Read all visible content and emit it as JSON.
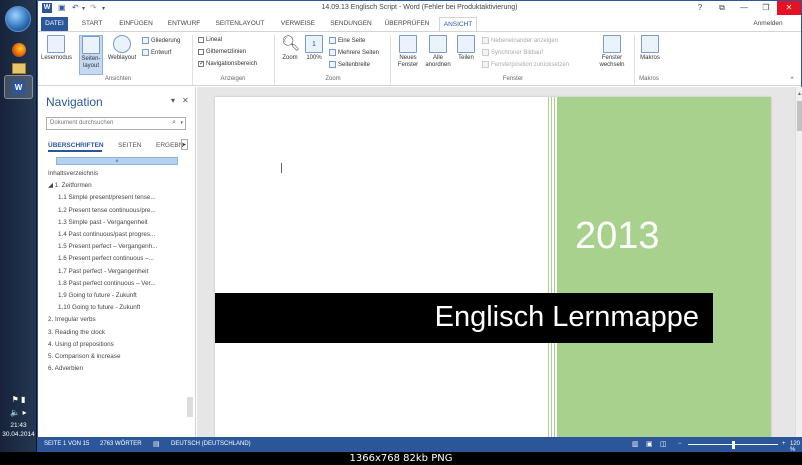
{
  "window": {
    "title": "14.09.13 Englisch Script - Word (Fehler bei Produktaktivierung)",
    "help": "?",
    "signin": "Anmelden"
  },
  "tabs": [
    "DATEI",
    "START",
    "EINFÜGEN",
    "ENTWURF",
    "SEITENLAYOUT",
    "VERWEISE",
    "SENDUNGEN",
    "ÜBERPRÜFEN",
    "ANSICHT"
  ],
  "ribbon": {
    "ansichten": {
      "label": "Ansichten",
      "lesemodus": "Lesemodus",
      "seitenlayout": "Seiten-\nlayout",
      "weblayout": "Weblayout",
      "gliederung": "Gliederung",
      "entwurf": "Entwurf"
    },
    "anzeigen": {
      "label": "Anzeigen",
      "lineal": "Lineal",
      "gitternetz": "Gitternetzlinien",
      "navbereich": "Navigationsbereich"
    },
    "zoom": {
      "label": "Zoom",
      "zoom": "Zoom",
      "pct": "100%",
      "eine": "Eine Seite",
      "mehrere": "Mehrere Seiten",
      "breite": "Seitenbreite"
    },
    "fenster": {
      "label": "Fenster",
      "neues": "Neues\nFenster",
      "alle": "Alle\nanordnen",
      "teilen": "Teilen",
      "nebeneinander": "Nebeneinander anzeigen",
      "synchron": "Synchroner Bildlauf",
      "zurueck": "Fensterposition zurücksetzen",
      "wechseln": "Fenster\nwechseln"
    },
    "makros": {
      "label": "Makros",
      "makros": "Makros"
    }
  },
  "nav": {
    "title": "Navigation",
    "search_placeholder": "Dokument durchsuchen",
    "tabs": [
      "ÜBERSCHRIFTEN",
      "SEITEN",
      "ERGEBN"
    ],
    "headings": [
      "Inhaltsverzeichnis",
      "◢ 1. Zeitformen",
      "1.1 Simple present/present tense...",
      "1.2 Present tense continuous/pre...",
      "1.3 Simple past - Vergangenheit",
      "1.4 Past continuous/past progres...",
      "1.5 Present perfect – Vergangenh...",
      "1.6 Present perfect continuous –...",
      "1.7 Past perfect - Vergangenheit",
      "1.8 Past perfect continuous – Ver...",
      "1.9 Going to future - Zukunft",
      "1.10 Going to future - Zukunft",
      "2. Irregular verbs",
      "3. Reading the clock",
      "4. Using of prepositions",
      "5. Comparison & increase",
      "6. Adverbien"
    ]
  },
  "document": {
    "year": "2013",
    "title": "Englisch Lernmappe",
    "accent": "#a9d18e"
  },
  "status": {
    "page": "SEITE 1 VON 15",
    "words": "2763 WÖRTER",
    "lang": "DEUTSCH (DEUTSCHLAND)",
    "zoom": "120 %",
    "zoom_fraction": 0.5
  },
  "taskbar": {
    "time": "21:43",
    "date": "30.04.2014"
  },
  "caption": "1366x768  82kb  PNG"
}
